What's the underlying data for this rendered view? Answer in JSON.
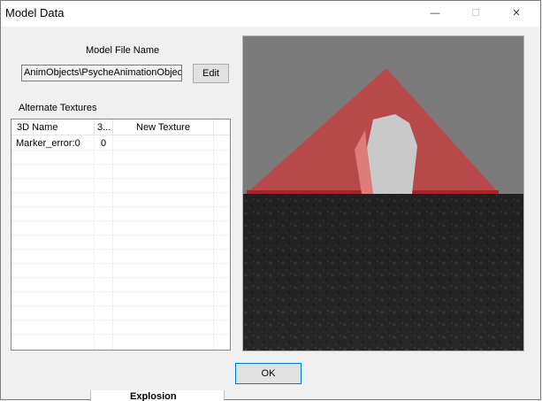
{
  "window": {
    "title": "Model Data",
    "controls": {
      "minimize": "—",
      "maximize": "☐",
      "close": "✕"
    }
  },
  "model": {
    "label": "Model File Name",
    "value": "AnimObjects\\PsycheAnimationObject",
    "edit_label": "Edit"
  },
  "textures": {
    "label": "Alternate Textures",
    "columns": [
      "3D Name",
      "3...",
      "New Texture"
    ],
    "rows": [
      {
        "name": "Marker_error:0",
        "num": "0",
        "texture": ""
      }
    ]
  },
  "ok_label": "OK",
  "background_text": "Explosion",
  "colors": {
    "triangle": "#c83a3e",
    "floor": "#262626",
    "sky": "#7b7b7b"
  }
}
